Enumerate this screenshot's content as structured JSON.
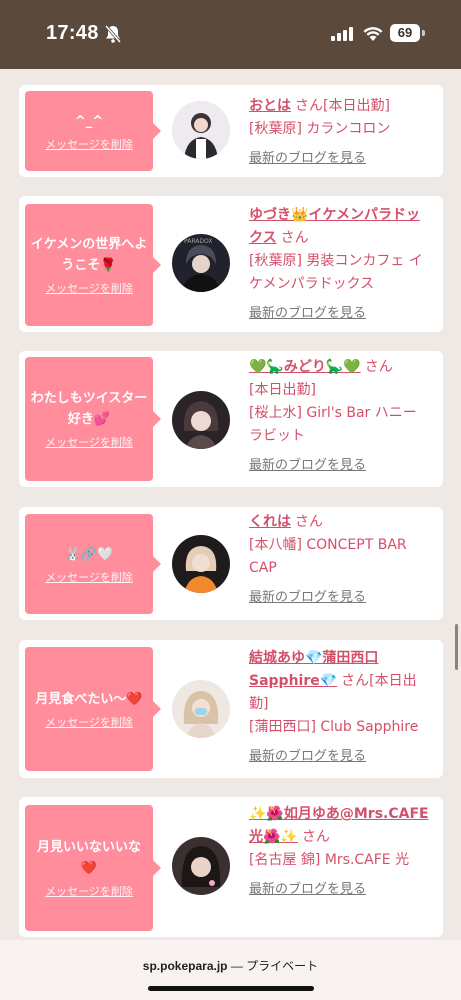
{
  "status_bar": {
    "time": "17:48",
    "battery": "69",
    "icons": [
      "bell-slash-icon",
      "signal-icon",
      "wifi-icon",
      "battery-icon"
    ]
  },
  "feed": {
    "delete_label": "メッセージを削除",
    "blog_label": "最新のブログを見る",
    "honorific": "さん",
    "cards": [
      {
        "message": "^_^",
        "name": "おとは",
        "status": "[本日出勤]",
        "shop": "[秋葉原] カランコロン"
      },
      {
        "message": "イケメンの世界へようこそ🌹",
        "name": "ゆづき👑イケメンパラドックス",
        "status": "",
        "shop": "[秋葉原] 男装コンカフェ イケメンパラドックス"
      },
      {
        "message": "わたしもツイスター好き💕",
        "name": "💚🦕みどり🦕💚",
        "status": "[本日出勤]",
        "shop": "[桜上水] Girl's Bar ハニーラビット"
      },
      {
        "message": "🐰🔗🤍",
        "name": "くれは",
        "status": "[本八幡]",
        "shop": "CONCEPT BAR CAP"
      },
      {
        "message": "月見食べたい〜❤️",
        "name": "結城あゆ💎蒲田西口Sapphire💎",
        "status": "[本日出勤]",
        "shop": "[蒲田西口] Club Sapphire"
      },
      {
        "message": "月見いいないいな❤️",
        "name": "✨🌺如月ゆあ@Mrs.CAFE光🌺✨",
        "status": "",
        "shop": "[名古屋 錦] Mrs.CAFE 光"
      }
    ]
  },
  "browser": {
    "domain": "sp.pokepara.jp",
    "separator": " — ",
    "mode": "プライベート"
  },
  "colors": {
    "status_bar_bg": "#5b4a3c",
    "bubble_bg": "#ff8d9c",
    "accent_text": "#d4506a",
    "page_bg": "#efe9e6"
  }
}
